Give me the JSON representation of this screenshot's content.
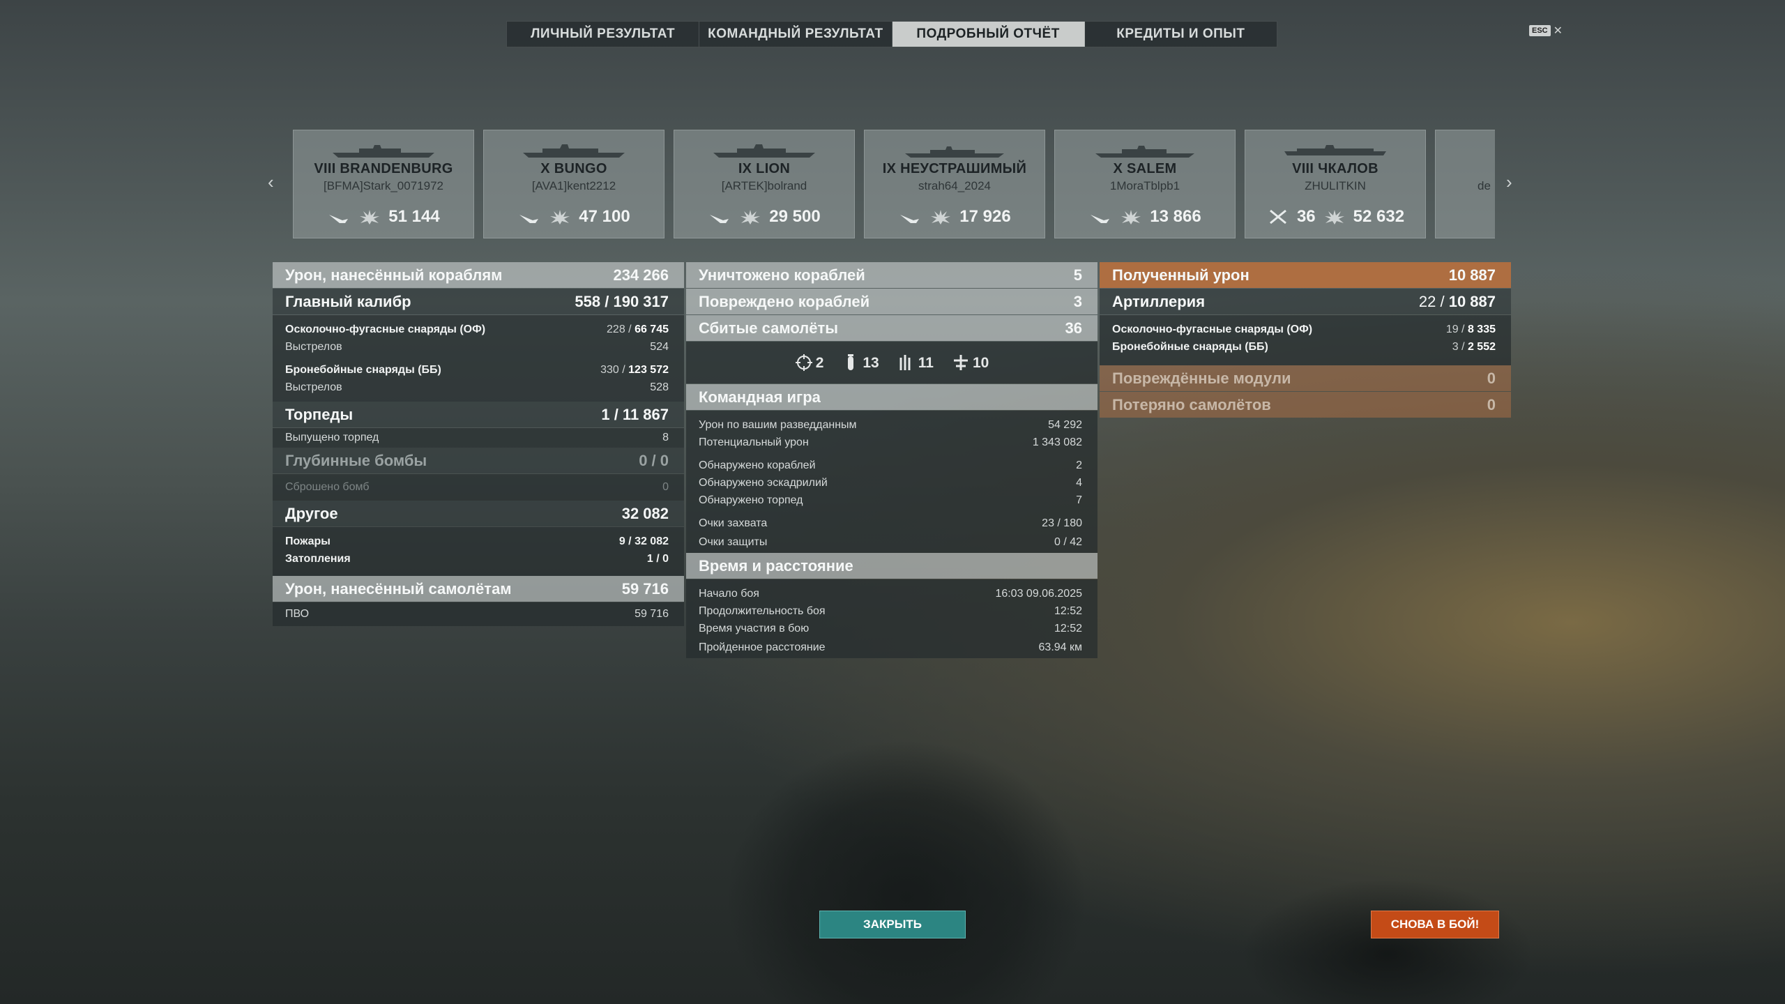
{
  "tabs": [
    "ЛИЧНЫЙ РЕЗУЛЬТАТ",
    "КОМАНДНЫЙ РЕЗУЛЬТАТ",
    "ПОДРОБНЫЙ ОТЧЁТ",
    "КРЕДИТЫ И ОПЫТ"
  ],
  "active_tab": 2,
  "esc_label": "ESC",
  "ships": [
    {
      "name": "VIII BRANDENBURG",
      "player": "[BFMA]Stark_0071972",
      "stats": [
        "51 144"
      ]
    },
    {
      "name": "X BUNGO",
      "player": "[AVA1]kent2212",
      "stats": [
        "47 100"
      ]
    },
    {
      "name": "IX LION",
      "player": "[ARTEK]bolrand",
      "stats": [
        "29 500"
      ]
    },
    {
      "name": "IX НЕУСТРАШИМЫЙ",
      "player": "strah64_2024",
      "stats": [
        "17 926"
      ]
    },
    {
      "name": "X SALEM",
      "player": "1MoraTblpb1",
      "stats": [
        "13 866"
      ]
    },
    {
      "name": "VIII ЧКАЛОВ",
      "player": "ZHULITKIN",
      "stats": [
        "36",
        "52 632"
      ]
    },
    {
      "name": "",
      "player": "de",
      "stats": []
    }
  ],
  "left": {
    "ship_damage": {
      "label": "Урон, нанесённый кораблям",
      "value": "234 266"
    },
    "main_battery": {
      "label": "Главный калибр",
      "hits": "558 / ",
      "dmg": "190 317"
    },
    "he": {
      "label": "Осколочно-фугасные снаряды (ОФ)",
      "hits": "228 / ",
      "dmg": "66 745"
    },
    "he_shots": {
      "label": "Выстрелов",
      "value": "524"
    },
    "ap": {
      "label": "Бронебойные снаряды (ББ)",
      "hits": "330 / ",
      "dmg": "123 572"
    },
    "ap_shots": {
      "label": "Выстрелов",
      "value": "528"
    },
    "torpedoes": {
      "label": "Торпеды",
      "hits": "1 / ",
      "dmg": "11 867"
    },
    "torp_launched": {
      "label": "Выпущено торпед",
      "value": "8"
    },
    "depth": {
      "label": "Глубинные бомбы",
      "value": "0 / 0"
    },
    "depth_dropped": {
      "label": "Сброшено бомб",
      "value": "0"
    },
    "other": {
      "label": "Другое",
      "value": "32 082"
    },
    "fires": {
      "label": "Пожары",
      "value": "9 / 32 082"
    },
    "floods": {
      "label": "Затопления",
      "value": "1 / 0"
    },
    "plane_damage": {
      "label": "Урон, нанесённый самолётам",
      "value": "59 716"
    },
    "aa": {
      "label": "ПВО",
      "value": "59 716"
    }
  },
  "middle": {
    "destroyed": {
      "label": "Уничтожено кораблей",
      "value": "5"
    },
    "damaged": {
      "label": "Повреждено кораблей",
      "value": "3"
    },
    "planes_shot": {
      "label": "Сбитые самолёты",
      "value": "36"
    },
    "plane_types": [
      "2",
      "13",
      "11",
      "10"
    ],
    "team_header": "Командная игра",
    "team": [
      {
        "label": "Урон по вашим разведданным",
        "value": "54 292"
      },
      {
        "label": "Потенциальный урон",
        "value": "1 343 082"
      },
      {
        "label": "Обнаружено кораблей",
        "value": "2"
      },
      {
        "label": "Обнаружено эскадрилий",
        "value": "4"
      },
      {
        "label": "Обнаружено торпед",
        "value": "7"
      },
      {
        "label": "Очки захвата",
        "value": "23 / 180"
      },
      {
        "label": "Очки защиты",
        "value": "0 / 42"
      }
    ],
    "time_header": "Время и расстояние",
    "time": [
      {
        "label": "Начало боя",
        "value": "16:03  09.06.2025"
      },
      {
        "label": "Продолжительность боя",
        "value": "12:52"
      },
      {
        "label": "Время участия в бою",
        "value": "12:52"
      },
      {
        "label": "Пройденное расстояние",
        "value": "63.94 км"
      }
    ]
  },
  "right": {
    "received": {
      "label": "Полученный урон",
      "value": "10 887"
    },
    "artillery": {
      "label": "Артиллерия",
      "hits": "22 / ",
      "dmg": "10 887"
    },
    "he": {
      "label": "Осколочно-фугасные снаряды (ОФ)",
      "hits": "19 / ",
      "dmg": "8 335"
    },
    "ap": {
      "label": "Бронебойные снаряды (ББ)",
      "hits": "3 / ",
      "dmg": "2 552"
    },
    "modules": {
      "label": "Повреждённые модули",
      "value": "0"
    },
    "planes_lost": {
      "label": "Потеряно самолётов",
      "value": "0"
    }
  },
  "buttons": {
    "close": "ЗАКРЫТЬ",
    "again": "СНОВА В БОЙ!"
  }
}
